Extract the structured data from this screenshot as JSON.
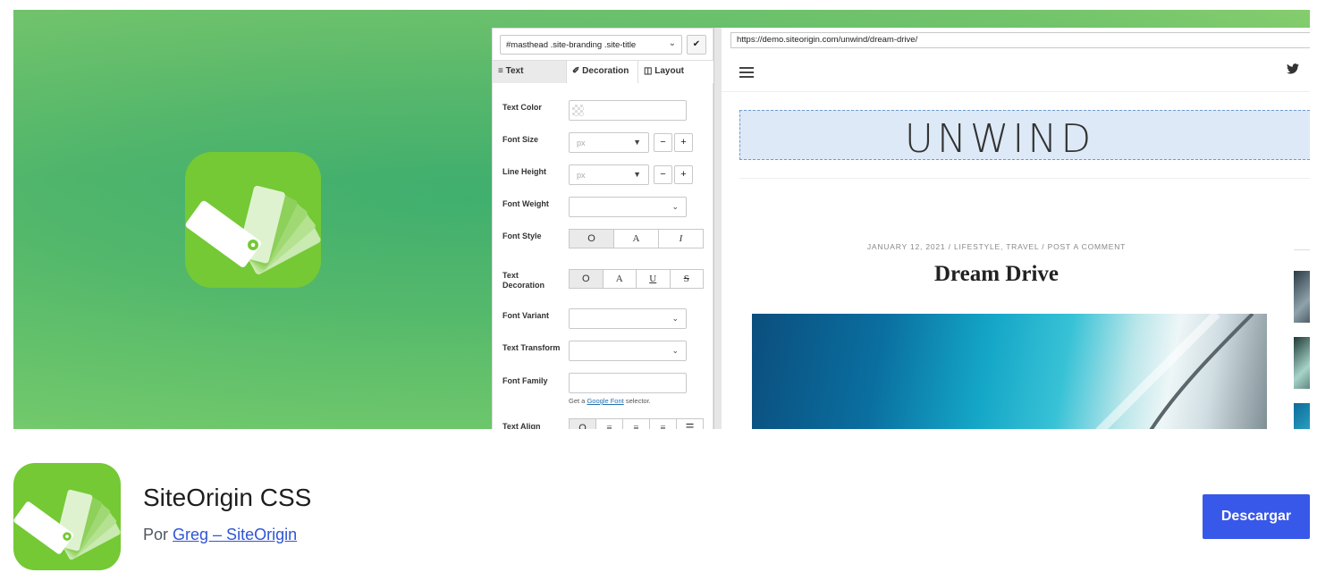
{
  "banner": {
    "editor": {
      "selector_value": "#masthead .site-branding .site-title",
      "tabs": [
        "Text",
        "Decoration",
        "Layout"
      ],
      "labels": {
        "text_color": "Text Color",
        "font_size": "Font Size",
        "line_height": "Line Height",
        "font_weight": "Font Weight",
        "font_style": "Font Style",
        "text_decoration": "Text Decoration",
        "font_variant": "Font Variant",
        "text_transform": "Text Transform",
        "font_family": "Font Family",
        "text_align": "Text Align"
      },
      "unit_placeholder": "px",
      "hint_prefix": "Get a",
      "hint_link": "Google Font",
      "hint_suffix": "selector."
    },
    "preview": {
      "url": "https://demo.siteorigin.com/unwind/dream-drive/",
      "site_logo": "UNWIND",
      "post_meta": "JANUARY 12, 2021   /   LIFESTYLE, TRAVEL   /   POST A COMMENT",
      "post_title": "Dream Drive"
    }
  },
  "plugin": {
    "name": "SiteOrigin CSS",
    "by_label": "Por",
    "author": "Greg – SiteOrigin",
    "download_label": "Descargar"
  },
  "colors": {
    "icon_green": "#74c935",
    "button_blue": "#3858e9",
    "link_blue": "#2f55d4"
  }
}
